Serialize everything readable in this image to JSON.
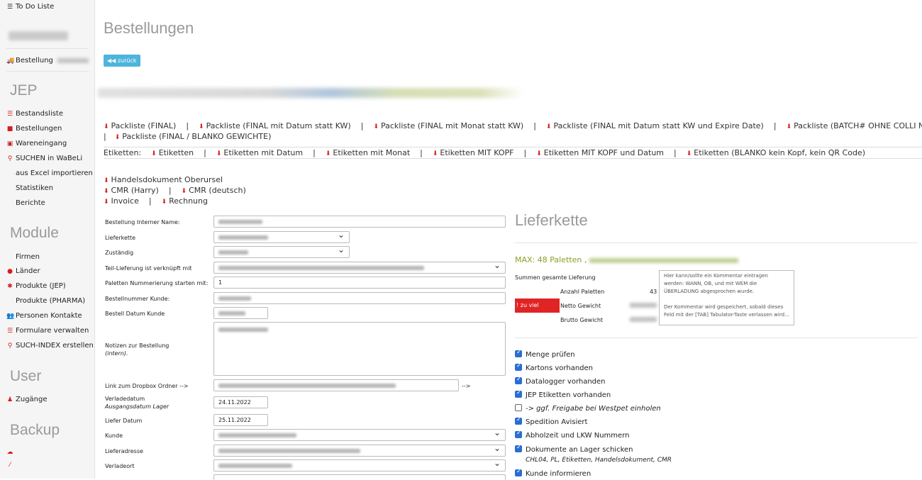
{
  "sidebar": {
    "todo": "To Do Liste",
    "bestellung": "Bestellung",
    "heading_jep": "JEP",
    "jep_items": [
      "Bestandsliste",
      "Bestellungen",
      "Wareneingang",
      "SUCHEN in WaBeLi",
      "aus Excel importieren",
      "Statistiken",
      "Berichte"
    ],
    "heading_module": "Module",
    "module_items": [
      "Firmen",
      "Länder",
      "Produkte (JEP)",
      "Produkte (PHARMA)",
      "Personen Kontakte",
      "Formulare verwalten",
      "SUCH-INDEX erstellen"
    ],
    "heading_user": "User",
    "user_items": [
      "Zugänge"
    ],
    "heading_backup": "Backup"
  },
  "page": {
    "title": "Bestellungen",
    "back_label": "zurück"
  },
  "downloads": {
    "packliste": [
      "Packliste (FINAL)",
      "Packliste (FINAL mit Datum statt KW)",
      "Packliste (FINAL mit Monat statt KW)",
      "Packliste (FINAL mit Datum statt KW und Expire Date)",
      "Packliste (BATCH# OHNE COLLI NUMMERN)"
    ],
    "packliste_blanko": "Packliste (FINAL / BLANKO GEWICHTE)",
    "etiketten_label": "Etiketten:",
    "etiketten": [
      "Etiketten",
      "Etiketten mit Datum",
      "Etiketten mit Monat",
      "Etiketten MIT KOPF",
      "Etiketten MIT KOPF und Datum",
      "Etiketten (BLANKO kein Kopf, kein QR Code)"
    ],
    "handelsdokument": "Handelsdokument Oberursel",
    "cmr_harry": "CMR (Harry)",
    "cmr_deutsch": "CMR (deutsch)",
    "invoice": "Invoice",
    "rechnung": "Rechnung",
    "separator": "|"
  },
  "form": {
    "interner_name": "Bestellung Interner Name:",
    "lieferkette": "Lieferkette",
    "zustaendig": "Zuständig",
    "teil_lieferung": "Teil-Lieferung ist verknüpft mit",
    "paletten_nummerierung": "Paletten Nummerierung starten mit:",
    "paletten_value": "1",
    "bestellnummer": "Bestellnummer Kunde:",
    "bestell_datum": "Bestell Datum Kunde",
    "notizen": "Notizen zur Bestellung",
    "notizen_sub": "(intern).",
    "dropbox": "Link zum Dropbox Ordner -->",
    "dropbox_arrow": "-->",
    "verladedatum": "Verladedatum",
    "verladedatum_sub": "Ausgangsdatum Lager",
    "verladedatum_value": "24.11.2022",
    "liefer_datum": "Liefer Datum",
    "liefer_datum_value": "25.11.2022",
    "kunde": "Kunde",
    "lieferadresse": "Lieferadresse",
    "verladeort": "Verladeort"
  },
  "lieferkette": {
    "title": "Lieferkette",
    "max_text": "MAX: 48 Paletten ,",
    "summen": "Summen gesamte Lieferung",
    "anzahl_paletten": "Anzahl Paletten",
    "anzahl_value": "43",
    "netto": "Netto Gewicht",
    "brutto": "Brutto Gewicht",
    "zu_viel": "! zu viel",
    "comment": "Hier kann/sollte ein Kommentar eintragen werden: WANN, OB, und mit WEM die ÜBERLADUNG abgesprochen wurde.\n\nDer Kommentar wird gespeichert, sobald dieses Feld mit der [TAB] Tabulator-Taste verlassen wird..."
  },
  "checklist": [
    {
      "label": "Menge prüfen",
      "checked": true
    },
    {
      "label": "Kartons vorhanden",
      "checked": true
    },
    {
      "label": "Datalogger vorhanden",
      "checked": true
    },
    {
      "label": "JEP Etiketten vorhanden",
      "checked": true
    },
    {
      "label": "-> ggf. Freigabe bei Westpet einholen",
      "checked": false
    },
    {
      "label": "Spedition Avisiert",
      "checked": true
    },
    {
      "label": "Abholzeit und LKW Nummern",
      "checked": true
    },
    {
      "label": "Dokumente an Lager schicken",
      "checked": true
    },
    {
      "label": "Kunde informieren",
      "checked": true
    }
  ],
  "checklist_note": "CHL04, PL, Etiketten, Handelsdokument, CMR",
  "colors": {
    "accent": "#4db5dc",
    "download_icon": "#d21f1f",
    "warning": "#e02424",
    "max_text": "#8aa122",
    "checkbox": "#2a6ed1"
  }
}
